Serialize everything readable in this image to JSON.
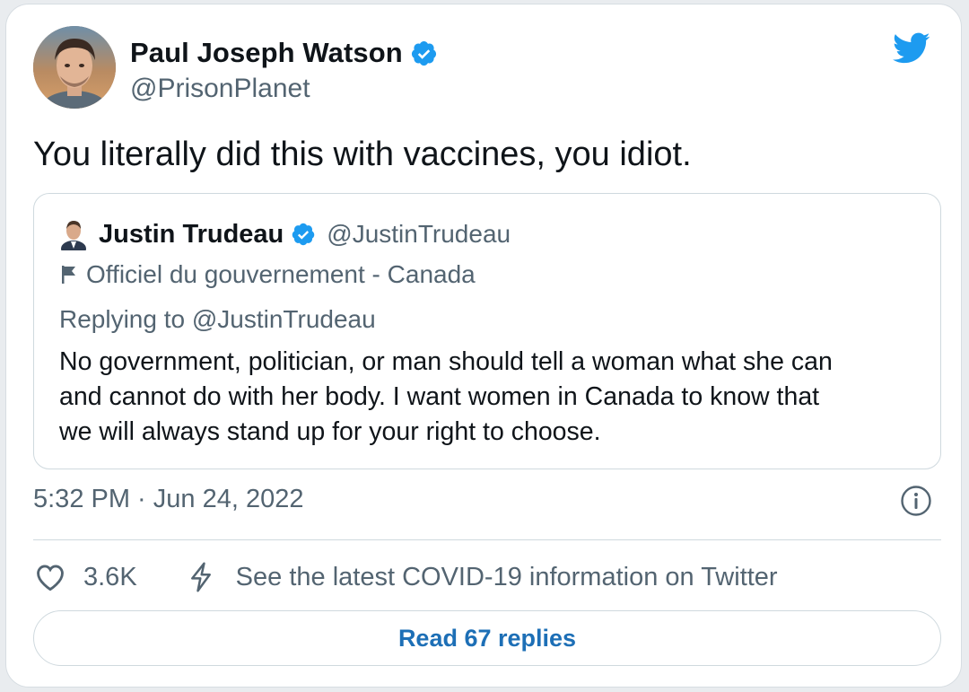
{
  "tweet": {
    "author": {
      "name": "Paul Joseph Watson",
      "handle": "@PrisonPlanet",
      "verified": true
    },
    "text": "You literally did this with vaccines, you idiot.",
    "timestamp": "5:32 PM · Jun 24, 2022",
    "likes": "3.6K",
    "covid_notice": "See the latest COVID-19 information on Twitter",
    "read_replies": "Read 67 replies"
  },
  "quoted_tweet": {
    "author": {
      "name": "Justin Trudeau",
      "handle": "@JustinTrudeau",
      "verified": true
    },
    "label": "Officiel du gouvernement - Canada",
    "replying_to": "Replying to @JustinTrudeau",
    "text_lines": [
      "No government, politician, or man should tell a woman what she can",
      "and cannot do with her body. I want women in Canada to know that",
      "we will always stand up for your right to choose."
    ]
  },
  "icons": {
    "brand": "twitter-bird-icon",
    "verified": "verified-badge-icon",
    "flag": "flag-icon",
    "info": "info-icon",
    "like": "heart-icon",
    "covid": "bolt-icon"
  },
  "colors": {
    "brand_blue": "#1d9bf0",
    "link_blue": "#1d6fb6",
    "text_primary": "#0f1419",
    "text_secondary": "#536471",
    "border": "#cfd9de"
  }
}
